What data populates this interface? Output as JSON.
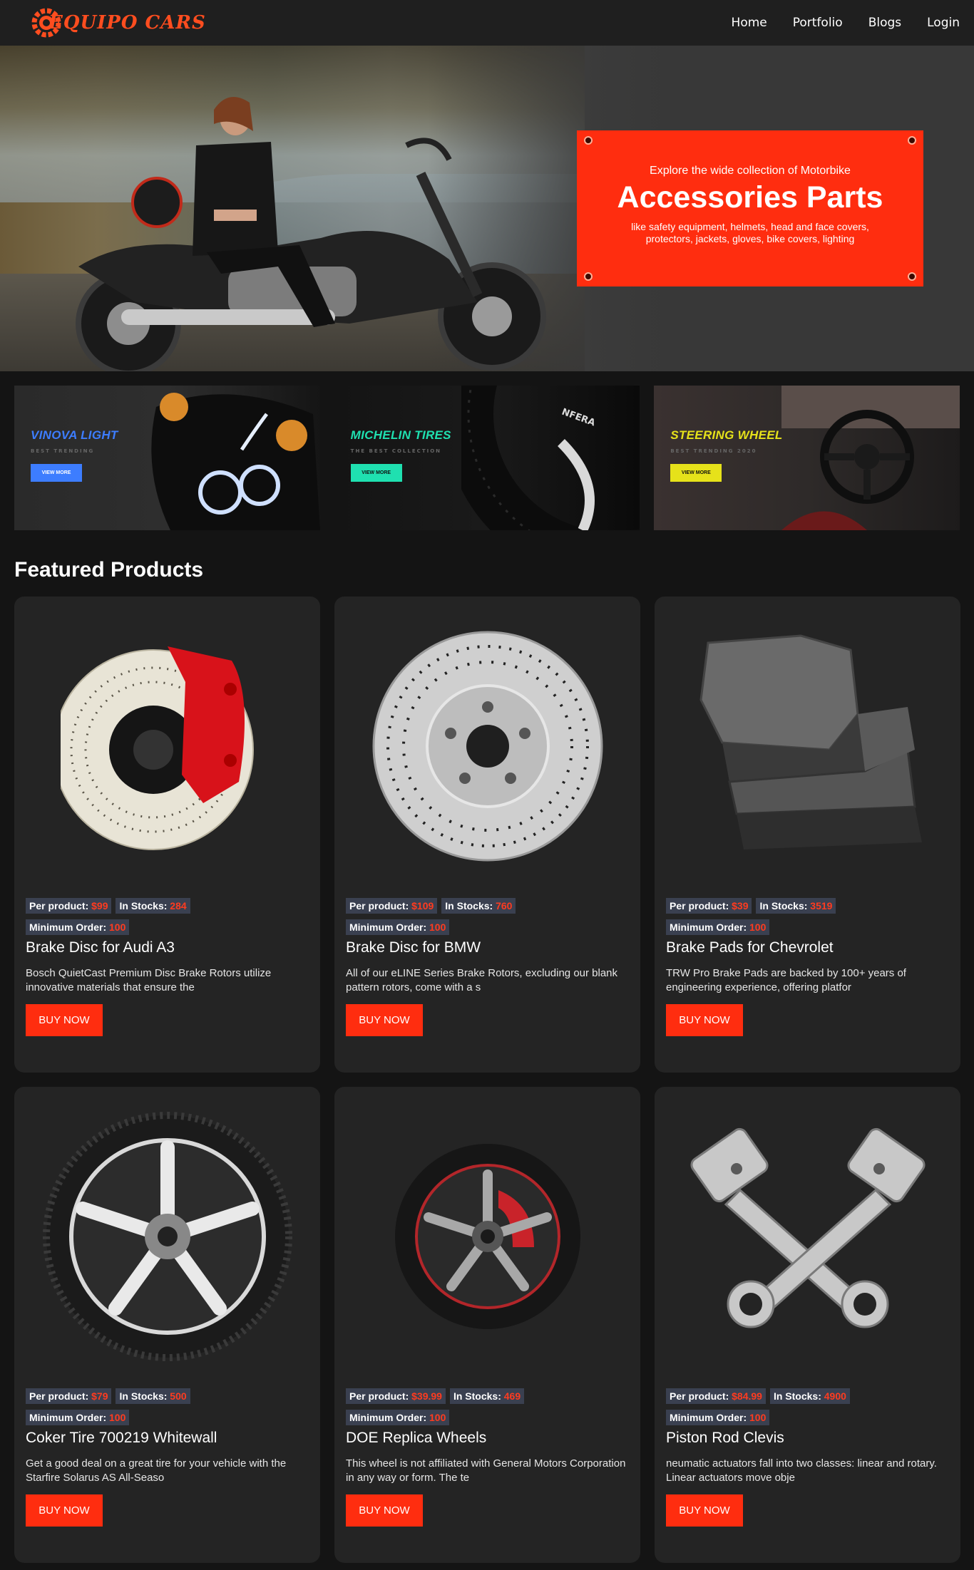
{
  "nav": {
    "brand": "EQUIPO CARS",
    "links": [
      "Home",
      "Portfolio",
      "Blogs",
      "Login"
    ]
  },
  "hero": {
    "kicker": "Explore the wide collection of Motorbike",
    "title": "Accessories Parts",
    "description": "like safety equipment, helmets, head and face covers, protectors, jackets, gloves, bike covers, lighting"
  },
  "promos": [
    {
      "title": "VINOVA LIGHT",
      "subtitle": "BEST TRENDING",
      "button": "VIEW MORE",
      "color": "#3d7dff"
    },
    {
      "title": "MICHELIN TIRES",
      "subtitle": "THE BEST COLLECTION",
      "button": "VIEW MORE",
      "color": "#1fe0b0"
    },
    {
      "title": "STEERING WHEEL",
      "subtitle": "BEST TRENDING 2020",
      "button": "VIEW MORE",
      "color": "#e6e21a"
    }
  ],
  "featured": {
    "title": "Featured Products",
    "labels": {
      "price": "Per product:",
      "stock": "In Stocks:",
      "min": "Minimum Order:",
      "buy": "BUY NOW"
    },
    "products": [
      {
        "price": "$99",
        "stock": "284",
        "min": "100",
        "name": "Brake Disc for Audi A3",
        "desc": "Bosch QuietCast Premium Disc Brake Rotors utilize innovative materials that ensure the",
        "icon": "brake-disc-caliper-icon"
      },
      {
        "price": "$109",
        "stock": "760",
        "min": "100",
        "name": "Brake Disc for BMW",
        "desc": "All of our eLINE Series Brake Rotors, excluding our blank pattern rotors, come with a s",
        "icon": "brake-rotor-icon"
      },
      {
        "price": "$39",
        "stock": "3519",
        "min": "100",
        "name": "Brake Pads for Chevrolet",
        "desc": "TRW Pro Brake Pads are backed by 100+ years of engineering experience, offering platfor",
        "icon": "brake-pads-icon"
      },
      {
        "price": "$79",
        "stock": "500",
        "min": "100",
        "name": "Coker Tire 700219 Whitewall",
        "desc": "Get a good deal on a great tire for your vehicle with the Starfire Solarus AS All-Seaso",
        "icon": "tire-wheel-icon"
      },
      {
        "price": "$39.99",
        "stock": "469",
        "min": "100",
        "name": "DOE Replica Wheels",
        "desc": "This wheel is not affiliated with General Motors Corporation in any way or form. The te",
        "icon": "replica-wheel-icon"
      },
      {
        "price": "$84.99",
        "stock": "4900",
        "min": "100",
        "name": "Piston Rod Clevis",
        "desc": "neumatic actuators fall into two classes: linear and rotary. Linear actuators move obje",
        "icon": "piston-rods-icon"
      }
    ]
  },
  "colors": {
    "accent": "#ff2d0f",
    "background": "#141414",
    "card": "#242424",
    "tag": "#3a4050"
  }
}
